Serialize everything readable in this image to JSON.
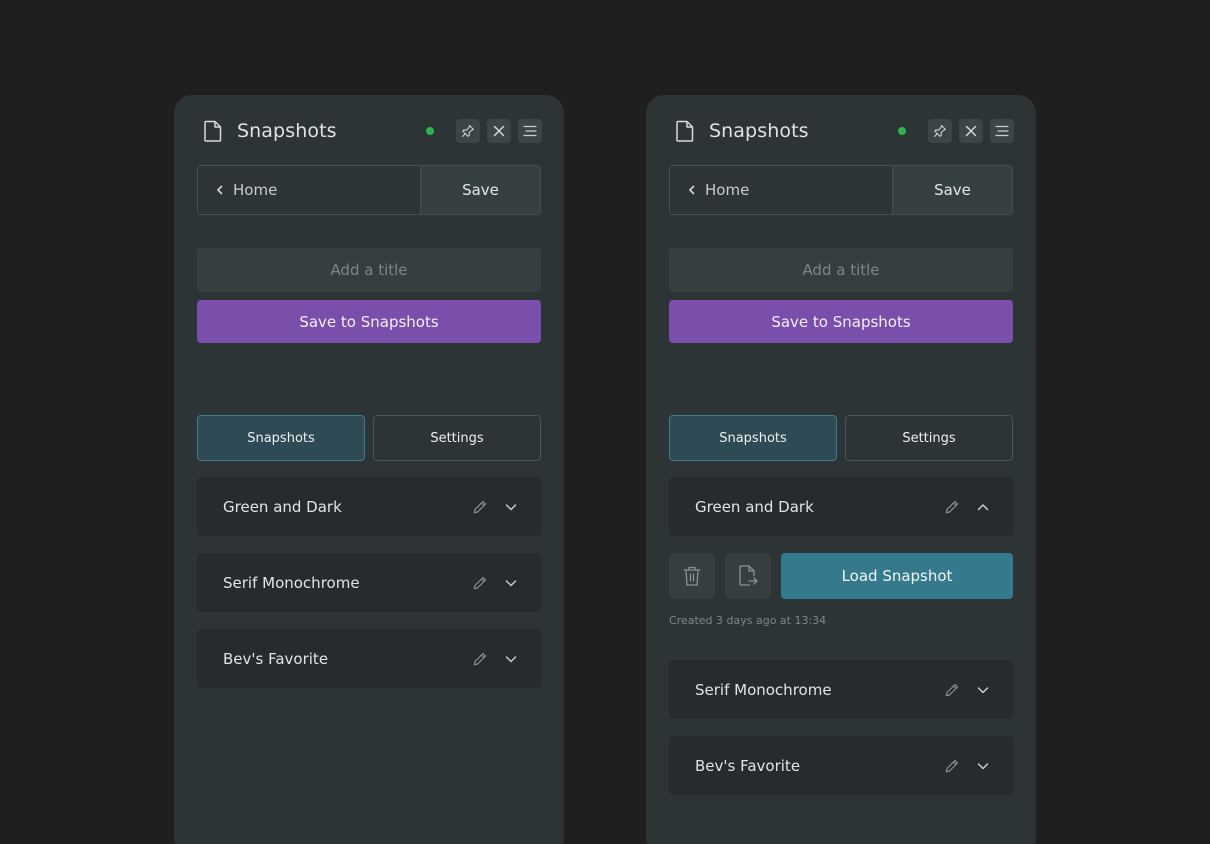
{
  "panels": [
    {
      "title": "Snapshots",
      "nav": {
        "home": "Home",
        "save": "Save"
      },
      "title_input": {
        "placeholder": "Add a title",
        "value": ""
      },
      "save_button": "Save to Snapshots",
      "tabs": [
        "Snapshots",
        "Settings"
      ],
      "items": [
        {
          "label": "Green and Dark",
          "expanded": false
        },
        {
          "label": "Serif Monochrome",
          "expanded": false
        },
        {
          "label": "Bev's Favorite",
          "expanded": false
        }
      ]
    },
    {
      "title": "Snapshots",
      "nav": {
        "home": "Home",
        "save": "Save"
      },
      "title_input": {
        "placeholder": "Add a title",
        "value": ""
      },
      "save_button": "Save to Snapshots",
      "tabs": [
        "Snapshots",
        "Settings"
      ],
      "items": [
        {
          "label": "Green and Dark",
          "expanded": true
        },
        {
          "label": "Serif Monochrome",
          "expanded": false
        },
        {
          "label": "Bev's Favorite",
          "expanded": false
        }
      ],
      "expanded_item": {
        "load_button": "Load Snapshot",
        "created": "Created 3 days ago at 13:34",
        "icons": [
          "trash-icon",
          "export-file-icon"
        ]
      }
    }
  ],
  "icons": {
    "header": [
      "document-icon",
      "pin-icon",
      "close-icon",
      "menu-icon"
    ],
    "item": [
      "pencil-icon",
      "chevron-down-icon",
      "chevron-up-icon"
    ],
    "nav": "chevron-left-icon"
  },
  "colors": {
    "background": "#1f1f1f",
    "panel": "#2c3436",
    "primary_purple": "#7a4fac",
    "load_teal": "#347a8c",
    "status_green": "#2fb34a",
    "active_tab": "#2e4a55"
  }
}
